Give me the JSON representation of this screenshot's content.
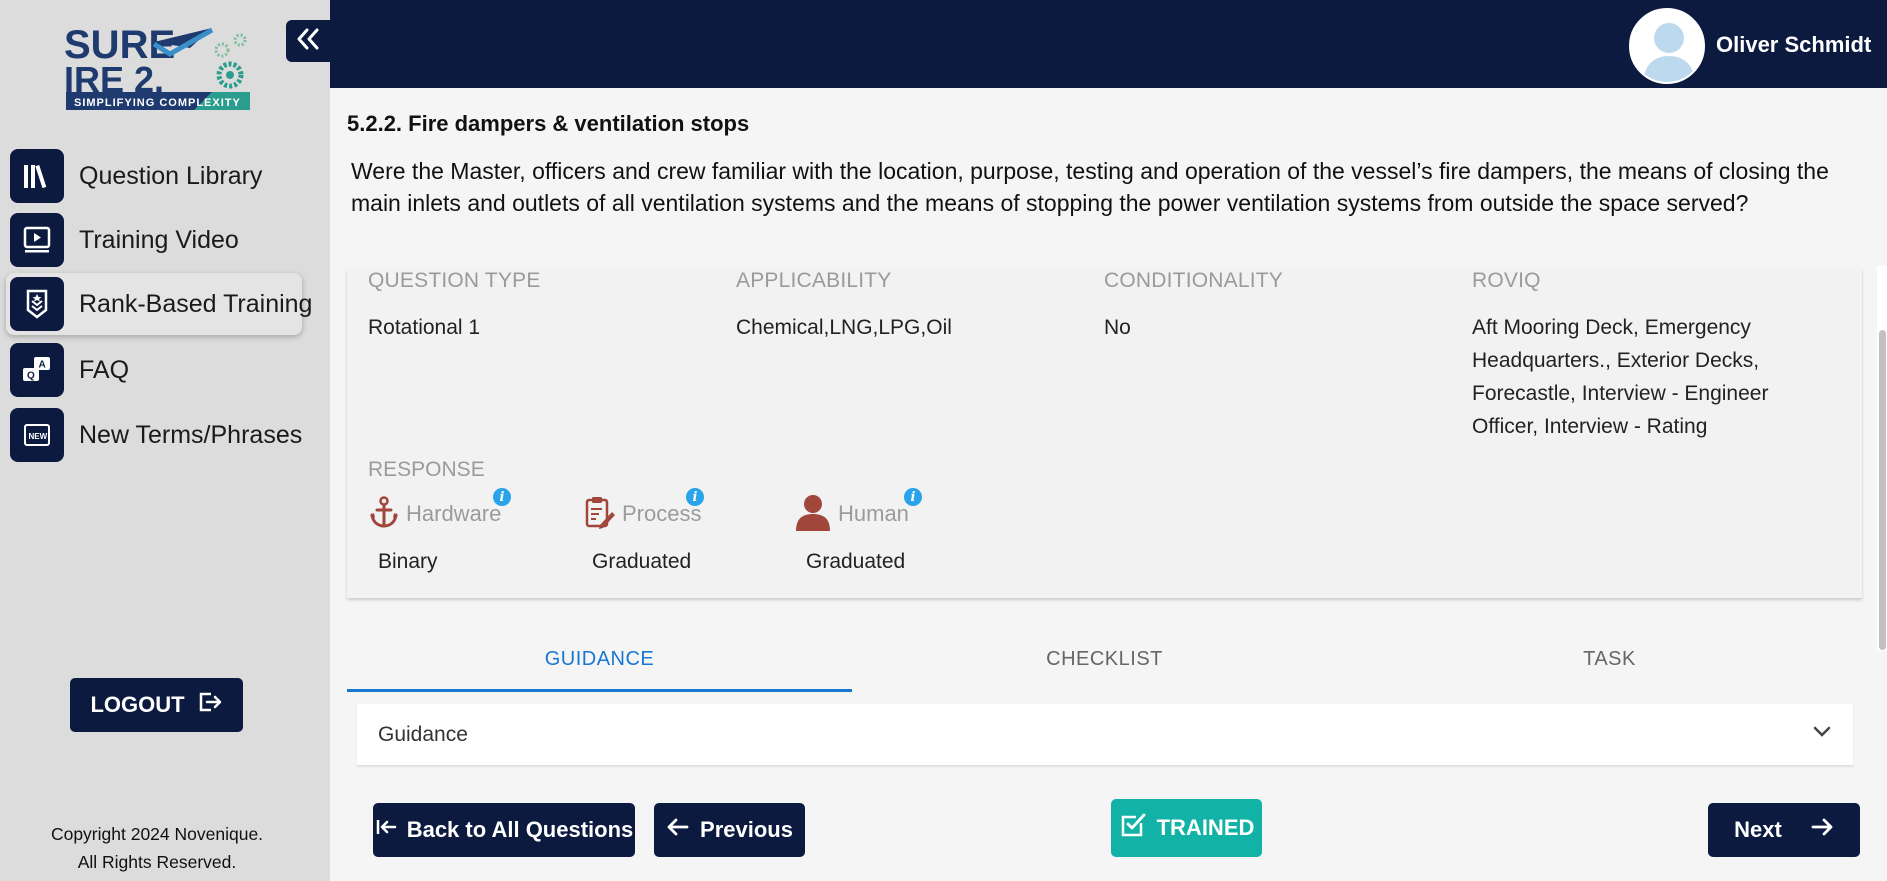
{
  "logo": {
    "line1": "SURE",
    "line2": "IRE 2.",
    "tagline": "SIMPLIFYING COMPLEXITY"
  },
  "sidebar": {
    "items": [
      {
        "label": "Question Library",
        "icon": "books-icon"
      },
      {
        "label": "Training Video",
        "icon": "video-icon"
      },
      {
        "label": "Rank-Based Training",
        "icon": "rank-badge-icon"
      },
      {
        "label": "FAQ",
        "icon": "qa-bubbles-icon"
      },
      {
        "label": "New Terms/Phrases",
        "icon": "new-badge-icon"
      }
    ],
    "logout_label": "LOGOUT",
    "copyright_line1": "Copyright 2024 Novenique.",
    "copyright_line2": "All Rights Reserved."
  },
  "header": {
    "user_name": "Oliver Schmidt"
  },
  "question": {
    "section_title": "5.2.2. Fire dampers & ventilation stops",
    "text": "Were the Master, officers and crew familiar with the location, purpose, testing and operation of the vessel’s fire dampers, the means of closing the main inlets and outlets of all ventilation systems and the means of stopping the power ventilation systems from outside the space served?"
  },
  "meta": {
    "question_type": {
      "head": "QUESTION TYPE",
      "value": "Rotational 1"
    },
    "applicability": {
      "head": "APPLICABILITY",
      "value": "Chemical,LNG,LPG,Oil"
    },
    "conditionality": {
      "head": "CONDITIONALITY",
      "value": "No"
    },
    "roviq": {
      "head": "ROVIQ",
      "value": "Aft Mooring Deck, Emergency Headquarters., Exterior Decks, Forecastle, Interview - Engineer Officer, Interview - Rating"
    },
    "response_head": "RESPONSE",
    "responses": [
      {
        "label": "Hardware",
        "value": "Binary",
        "icon": "anchor-icon"
      },
      {
        "label": "Process",
        "value": "Graduated",
        "icon": "clipboard-edit-icon"
      },
      {
        "label": "Human",
        "value": "Graduated",
        "icon": "person-icon"
      }
    ],
    "info_glyph": "i"
  },
  "tabs": [
    "GUIDANCE",
    "CHECKLIST",
    "TASK"
  ],
  "active_tab": "GUIDANCE",
  "accordion": {
    "title": "Guidance"
  },
  "footer": {
    "back_label": "Back to All Questions",
    "previous_label": "Previous",
    "trained_label": "TRAINED",
    "next_label": "Next"
  },
  "colors": {
    "navy": "#0b1a3e",
    "accent_blue": "#1976d2",
    "teal": "#13b2a6",
    "icon_red": "#a0463a",
    "info_blue": "#29a3ea"
  }
}
